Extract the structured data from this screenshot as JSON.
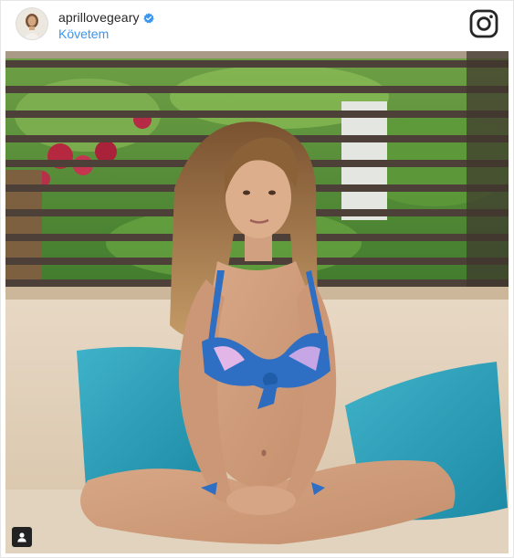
{
  "post": {
    "username": "aprillovegeary",
    "follow_label": "Követem",
    "verified": true
  },
  "icons": {
    "verified": "verified-badge-icon",
    "logo": "instagram-logo-icon",
    "tag": "user-tag-icon"
  },
  "colors": {
    "link": "#3897f0",
    "verified": "#3897f0",
    "username": "#262626"
  }
}
